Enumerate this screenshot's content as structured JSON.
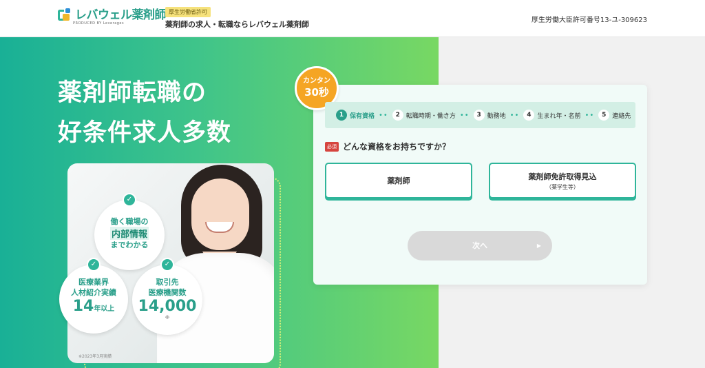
{
  "header": {
    "logo_text": "レバウェル薬剤師",
    "logo_sub": "PRODUCED BY Leverages",
    "license_badge": "厚生労働省許可",
    "tagline": "薬剤師の求人・転職ならレバウェル薬剤師",
    "license_number": "厚生労働大臣許可番号13-ユ-309623"
  },
  "hero": {
    "title_line1": "薬剤師転職の",
    "title_line2": "好条件求人多数",
    "badges": [
      {
        "line1": "働く職場の",
        "highlight": "内部情報",
        "line3": "までわかる"
      },
      {
        "line1": "医療業界",
        "line2": "人材紹介実績",
        "big": "14",
        "suffix": "年以上"
      },
      {
        "line1": "取引先",
        "line2": "医療機関数",
        "big": "14,000",
        "mark": "※"
      }
    ],
    "note": "※2023年3月実績"
  },
  "form": {
    "badge_line1": "カンタン",
    "badge_line2": "30秒",
    "steps": [
      {
        "num": "1",
        "label": "保有資格"
      },
      {
        "num": "2",
        "label": "転職時期・働き方"
      },
      {
        "num": "3",
        "label": "勤務地"
      },
      {
        "num": "4",
        "label": "生まれ年・名前"
      },
      {
        "num": "5",
        "label": "連絡先"
      }
    ],
    "required_label": "必須",
    "question": "どんな資格をお持ちですか？",
    "options": [
      {
        "label": "薬剤師",
        "sub": ""
      },
      {
        "label": "薬剤師免許取得見込",
        "sub": "（薬学生等）"
      }
    ],
    "next_label": "次へ",
    "next_arrow": "▶"
  },
  "colors": {
    "brand_green": "#2fb59a",
    "hero_gradient_start": "#19b096",
    "hero_gradient_end": "#78d863",
    "badge_orange": "#f5a524",
    "required_red": "#d6453f"
  }
}
